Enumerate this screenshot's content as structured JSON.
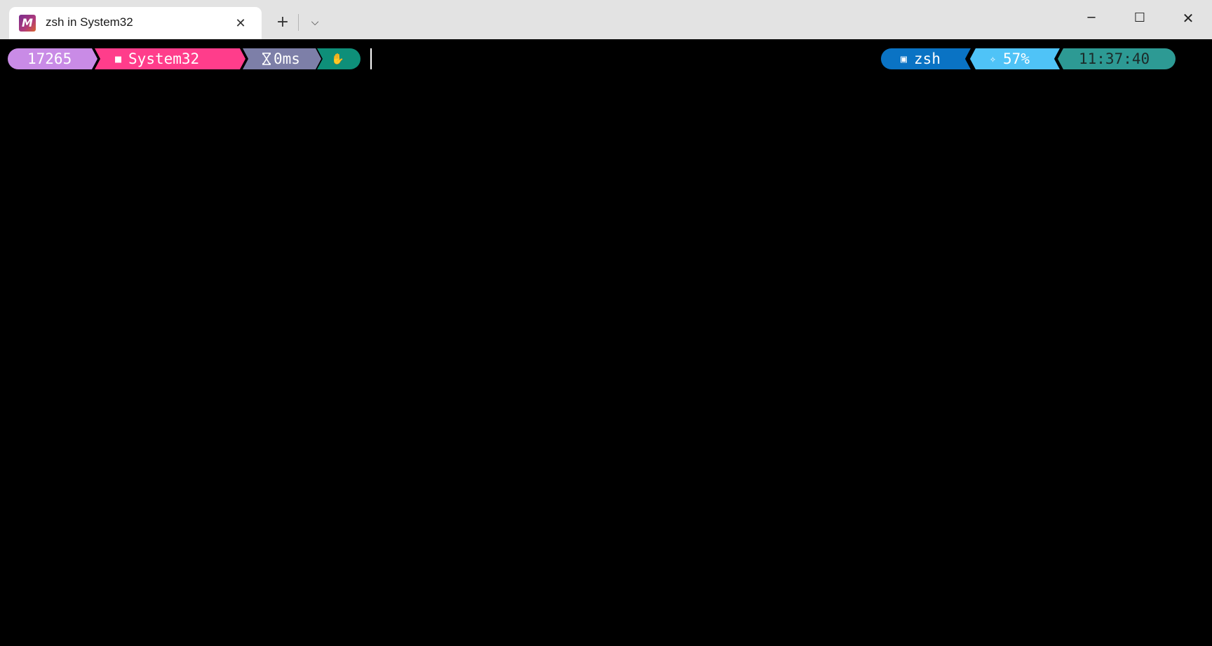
{
  "window": {
    "tab_icon_letter": "M",
    "tab_title": "zsh in System32",
    "tab_close_glyph": "✕",
    "new_tab_glyph": "+",
    "dropdown_glyph": "⌵",
    "minimize_glyph": "─",
    "maximize_glyph": "☐",
    "close_glyph": "✕"
  },
  "prompt": {
    "pid": "17265",
    "folder_icon": "■",
    "path": "System32",
    "duration": "0ms",
    "status_icon": "✋",
    "shell_icon": "▣",
    "shell": "zsh",
    "cpu_icon": "✧",
    "cpu": "57%",
    "time": "11:37:40"
  },
  "colors": {
    "pid_bg": "#c98be6",
    "path_bg": "#ff3d8b",
    "time_bg": "#7d7fa8",
    "status_bg": "#0e8f79",
    "shell_bg": "#0a73c4",
    "cpu_bg": "#4fc3f7",
    "clock_bg": "#2d9a94",
    "terminal_bg": "#000000",
    "titlebar_bg": "#e3e3e3"
  }
}
